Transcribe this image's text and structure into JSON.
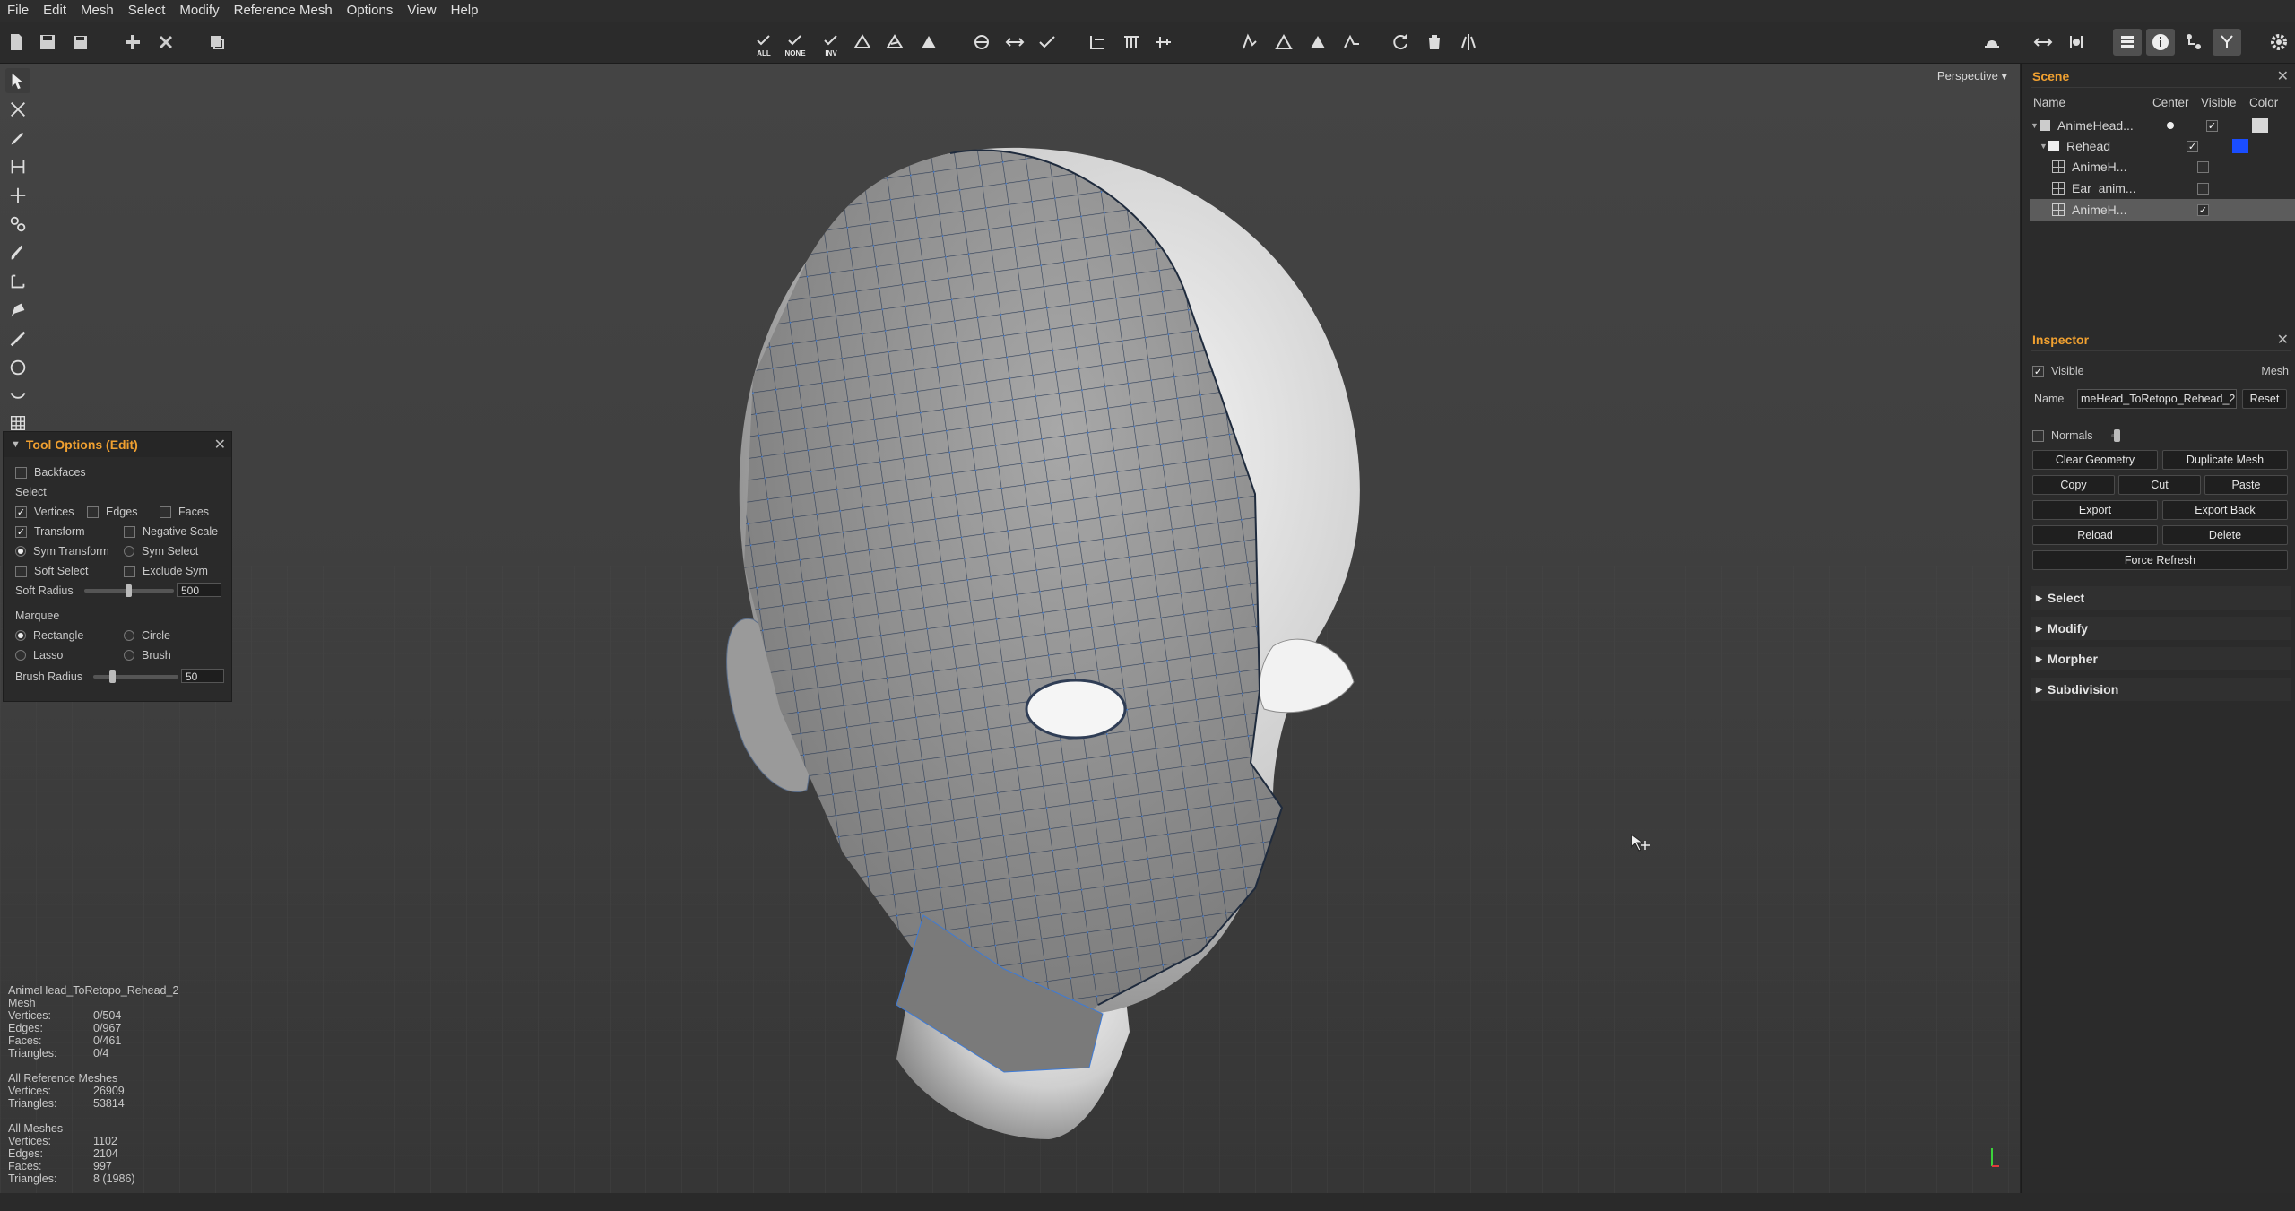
{
  "menu": [
    "File",
    "Edit",
    "Mesh",
    "Select",
    "Modify",
    "Reference Mesh",
    "Options",
    "View",
    "Help"
  ],
  "toolbar": {
    "all_label": "ALL",
    "none_label": "NONE",
    "inv_label": "INV"
  },
  "viewport": {
    "camera_mode": "Perspective",
    "camera_arrow": "▾"
  },
  "tool_options": {
    "title": "Tool Options (Edit)",
    "close": "✕",
    "check": "✓",
    "backfaces": "Backfaces",
    "select_heading": "Select",
    "vertices": "Vertices",
    "edges": "Edges",
    "faces": "Faces",
    "transform": "Transform",
    "negative_scale": "Negative Scale",
    "sym_transform": "Sym Transform",
    "sym_select": "Sym Select",
    "soft_select": "Soft Select",
    "exclude_sym": "Exclude Sym",
    "soft_radius_label": "Soft Radius",
    "soft_radius_value": "500",
    "marquee_heading": "Marquee",
    "rectangle": "Rectangle",
    "circle": "Circle",
    "lasso": "Lasso",
    "brush": "Brush",
    "brush_radius_label": "Brush Radius",
    "brush_radius_value": "50"
  },
  "stats": {
    "mesh_name": "AnimeHead_ToRetopo_Rehead_2",
    "mesh_label": "Mesh",
    "mesh_rows": [
      [
        "Vertices:",
        "0/504"
      ],
      [
        "Edges:",
        "0/967"
      ],
      [
        "Faces:",
        "0/461"
      ],
      [
        "Triangles:",
        "0/4"
      ]
    ],
    "ref_heading": "All Reference Meshes",
    "ref_rows": [
      [
        "Vertices:",
        "26909"
      ],
      [
        "Triangles:",
        "53814"
      ]
    ],
    "all_heading": "All Meshes",
    "all_rows": [
      [
        "Vertices:",
        "1102"
      ],
      [
        "Edges:",
        "2104"
      ],
      [
        "Faces:",
        "997"
      ],
      [
        "Triangles:",
        "8 (1986)"
      ]
    ]
  },
  "scene": {
    "title": "Scene",
    "close": "✕",
    "headers": {
      "name": "Name",
      "center": "Center",
      "visible": "Visible",
      "color": "Color"
    },
    "rows": [
      {
        "name": "AnimeHead...",
        "visible": "✓",
        "color": "#d8d8d8"
      },
      {
        "name": "Rehead",
        "visible": "✓",
        "color": "#1a4dff"
      },
      {
        "name": "AnimeH...",
        "visible": ""
      },
      {
        "name": "Ear_anim...",
        "visible": ""
      },
      {
        "name": "AnimeH...",
        "visible": "✓"
      }
    ]
  },
  "inspector": {
    "title": "Inspector",
    "close": "✕",
    "visible_label": "Visible",
    "check": "✓",
    "type": "Mesh",
    "name_label": "Name",
    "name_value": "meHead_ToRetopo_Rehead_2",
    "reset": "Reset",
    "normals": "Normals",
    "buttons": [
      "Clear Geometry",
      "Duplicate Mesh",
      "Copy",
      "Cut",
      "Paste",
      "Export",
      "Export Back",
      "Reload",
      "Delete",
      "Force Refresh"
    ],
    "sections": [
      "Select",
      "Modify",
      "Morpher",
      "Subdivision"
    ]
  },
  "colors": {
    "accent": "#f0a030",
    "selection_blue": "#1a4dff"
  }
}
